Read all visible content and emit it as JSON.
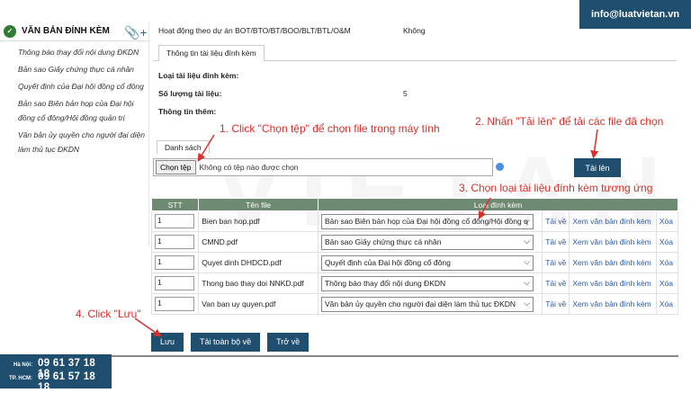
{
  "sidebar": {
    "title": "VĂN BẢN ĐÍNH KÈM",
    "items": [
      "Thông báo thay đổi nội dung ĐKDN",
      "Bản sao Giấy chứng thực cá nhân",
      "Quyết định của Đại hội đồng cổ đông",
      "Bản sao Biên bản họp của Đại hội đồng cổ đông/Hội đồng quản trị",
      "Văn bản ủy quyền cho người đại diện làm thủ tục ĐKDN"
    ]
  },
  "form": {
    "project_label": "Hoạt động theo dự án BOT/BTO/BT/BOO/BLT/BTL/O&M",
    "project_value": "Không",
    "tab_label": "Thông tin tài liệu đính kèm",
    "doc_type_label": "Loại tài liệu đính kèm:",
    "count_label": "Số lượng tài liệu:",
    "count_value": "5",
    "more_label": "Thông tin thêm:",
    "list_tab": "Danh sách",
    "choose_file": "Chọn tệp",
    "no_file": "Không có tệp nào được chọn",
    "upload": "Tải lên"
  },
  "table": {
    "headers": [
      "STT",
      "Tên file",
      "Loại đính kèm"
    ],
    "rows": [
      {
        "stt": "1",
        "file": "Bien ban hop.pdf",
        "type": "Bản sao Biên bản họp của Đại hội đồng cổ đông/Hội đồng q",
        "reload": "Tải về",
        "view": "Xem văn bản đính kèm",
        "del": "Xóa"
      },
      {
        "stt": "1",
        "file": "CMND.pdf",
        "type": "Bản sao Giấy chứng thực cá nhân",
        "reload": "Tải về",
        "view": "Xem văn bản đính kèm",
        "del": "Xóa"
      },
      {
        "stt": "1",
        "file": "Quyet dinh DHDCD.pdf",
        "type": "Quyết định của Đại hội đồng cổ đông",
        "reload": "Tải về",
        "view": "Xem văn bản đính kèm",
        "del": "Xóa"
      },
      {
        "stt": "1",
        "file": "Thong bao thay doi NNKD.pdf",
        "type": "Thông báo thay đổi nội dung ĐKDN",
        "reload": "Tải về",
        "view": "Xem văn bản đính kèm",
        "del": "Xóa"
      },
      {
        "stt": "1",
        "file": "Van ban uy quyen.pdf",
        "type": "Văn bản ủy quyền cho người đại diện làm thủ tục ĐKDN",
        "reload": "Tải về",
        "view": "Xem văn bản đính kèm",
        "del": "Xóa"
      }
    ]
  },
  "actions": {
    "save": "Lưu",
    "download_all": "Tải toàn bộ về",
    "back": "Trở về"
  },
  "annotations": {
    "a1": "1. Click \"Chọn tệp\" để chọn file trong máy tính",
    "a2": "2. Nhấn \"Tải lên\" để tải các file đã chọn",
    "a3": "3. Chọn loại tài liệu đính kèm tương ứng",
    "a4": "4. Click \"Lưu\""
  },
  "contact": {
    "email": "info@luatvietan.vn",
    "hanoi_label": "Hà Nội:",
    "hanoi_phone": "09 61 37 18 18",
    "hcm_label": "TP. HCM:",
    "hcm_phone": "09 61 57 18 18"
  },
  "watermark": "VIETAN",
  "colors": {
    "primary": "#1f4e6f",
    "header": "#6f8a72",
    "annotation": "#d6302a",
    "link": "#2b5aa6"
  }
}
